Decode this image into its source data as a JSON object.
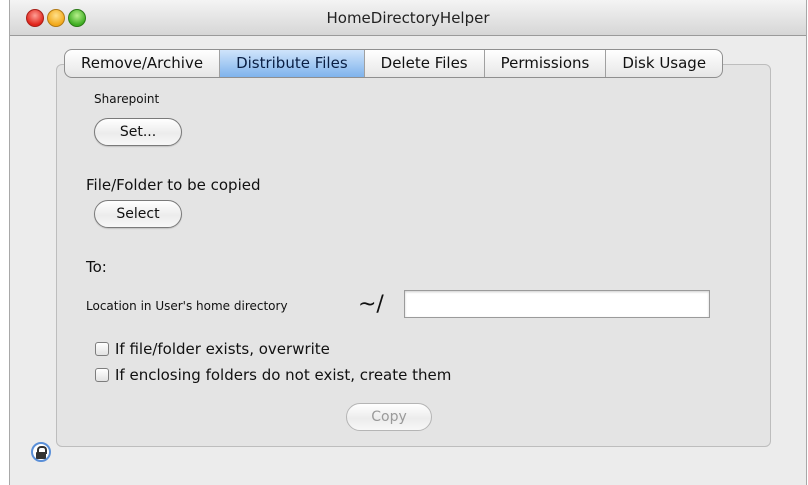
{
  "window": {
    "title": "HomeDirectoryHelper"
  },
  "tabs": [
    "Remove/Archive",
    "Distribute Files",
    "Delete Files",
    "Permissions",
    "Disk Usage"
  ],
  "active_tab": "Distribute Files",
  "sharepoint": {
    "label": "Sharepoint",
    "button": "Set..."
  },
  "source": {
    "label": "File/Folder to be copied",
    "button": "Select"
  },
  "destination": {
    "to_label": "To:",
    "location_label": "Location in User's home directory",
    "home_prefix": "~/",
    "path_value": ""
  },
  "options": {
    "overwrite": {
      "label": "If file/folder exists, overwrite",
      "checked": false
    },
    "create_folders": {
      "label": "If enclosing folders do not exist, create them",
      "checked": false
    }
  },
  "copy_button": {
    "label": "Copy",
    "enabled": false
  },
  "lock": {
    "icon": "lock-icon"
  }
}
